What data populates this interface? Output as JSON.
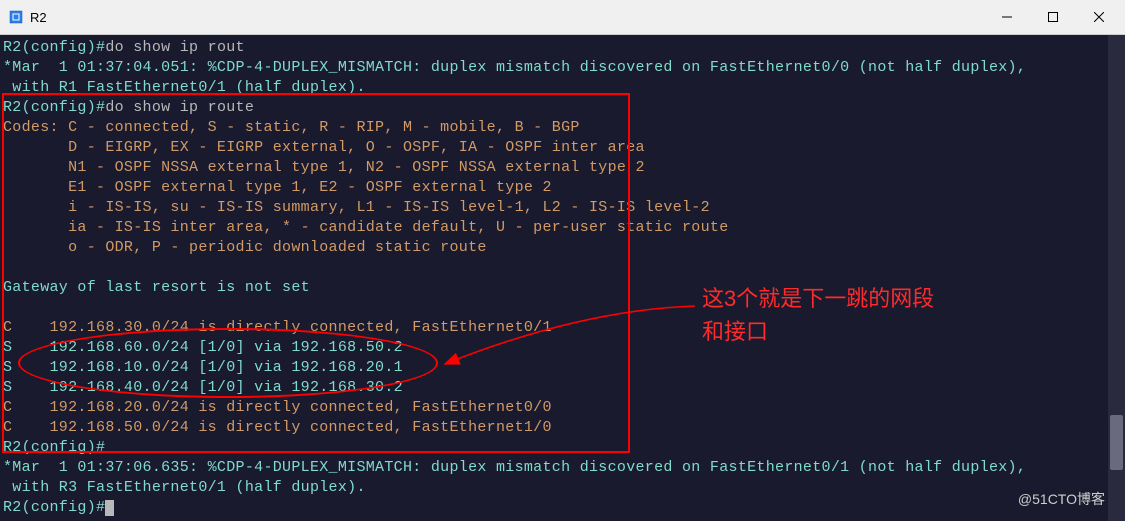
{
  "window": {
    "title": "R2"
  },
  "terminal": {
    "l1p": "R2(config)#",
    "l1c": "do show ip rout",
    "l2": "*Mar  1 01:37:04.051: %CDP-4-DUPLEX_MISMATCH: duplex mismatch discovered on FastEthernet0/0 (not half duplex),",
    "l3": " with R1 FastEthernet0/1 (half duplex).",
    "l4p": "R2(config)#",
    "l4c": "do show ip route",
    "l5": "Codes: C - connected, S - static, R - RIP, M - mobile, B - BGP",
    "l6": "       D - EIGRP, EX - EIGRP external, O - OSPF, IA - OSPF inter area",
    "l7": "       N1 - OSPF NSSA external type 1, N2 - OSPF NSSA external type 2",
    "l8": "       E1 - OSPF external type 1, E2 - OSPF external type 2",
    "l9": "       i - IS-IS, su - IS-IS summary, L1 - IS-IS level-1, L2 - IS-IS level-2",
    "l10": "       ia - IS-IS inter area, * - candidate default, U - per-user static route",
    "l11": "       o - ODR, P - periodic downloaded static route",
    "l12": " ",
    "l13": "Gateway of last resort is not set",
    "l14": " ",
    "l15": "C    192.168.30.0/24 is directly connected, FastEthernet0/1",
    "l16": "S    192.168.60.0/24 [1/0] via 192.168.50.2",
    "l17": "S    192.168.10.0/24 [1/0] via 192.168.20.1",
    "l18": "S    192.168.40.0/24 [1/0] via 192.168.30.2",
    "l19": "C    192.168.20.0/24 is directly connected, FastEthernet0/0",
    "l20": "C    192.168.50.0/24 is directly connected, FastEthernet1/0",
    "l21p": "R2(config)#",
    "l22": "*Mar  1 01:37:06.635: %CDP-4-DUPLEX_MISMATCH: duplex mismatch discovered on FastEthernet0/1 (not half duplex),",
    "l23": " with R3 FastEthernet0/1 (half duplex).",
    "l24p": "R2(config)#"
  },
  "annotation": {
    "line1": "这3个就是下一跳的网段",
    "line2": "和接口"
  },
  "watermark": "@51CTO博客"
}
